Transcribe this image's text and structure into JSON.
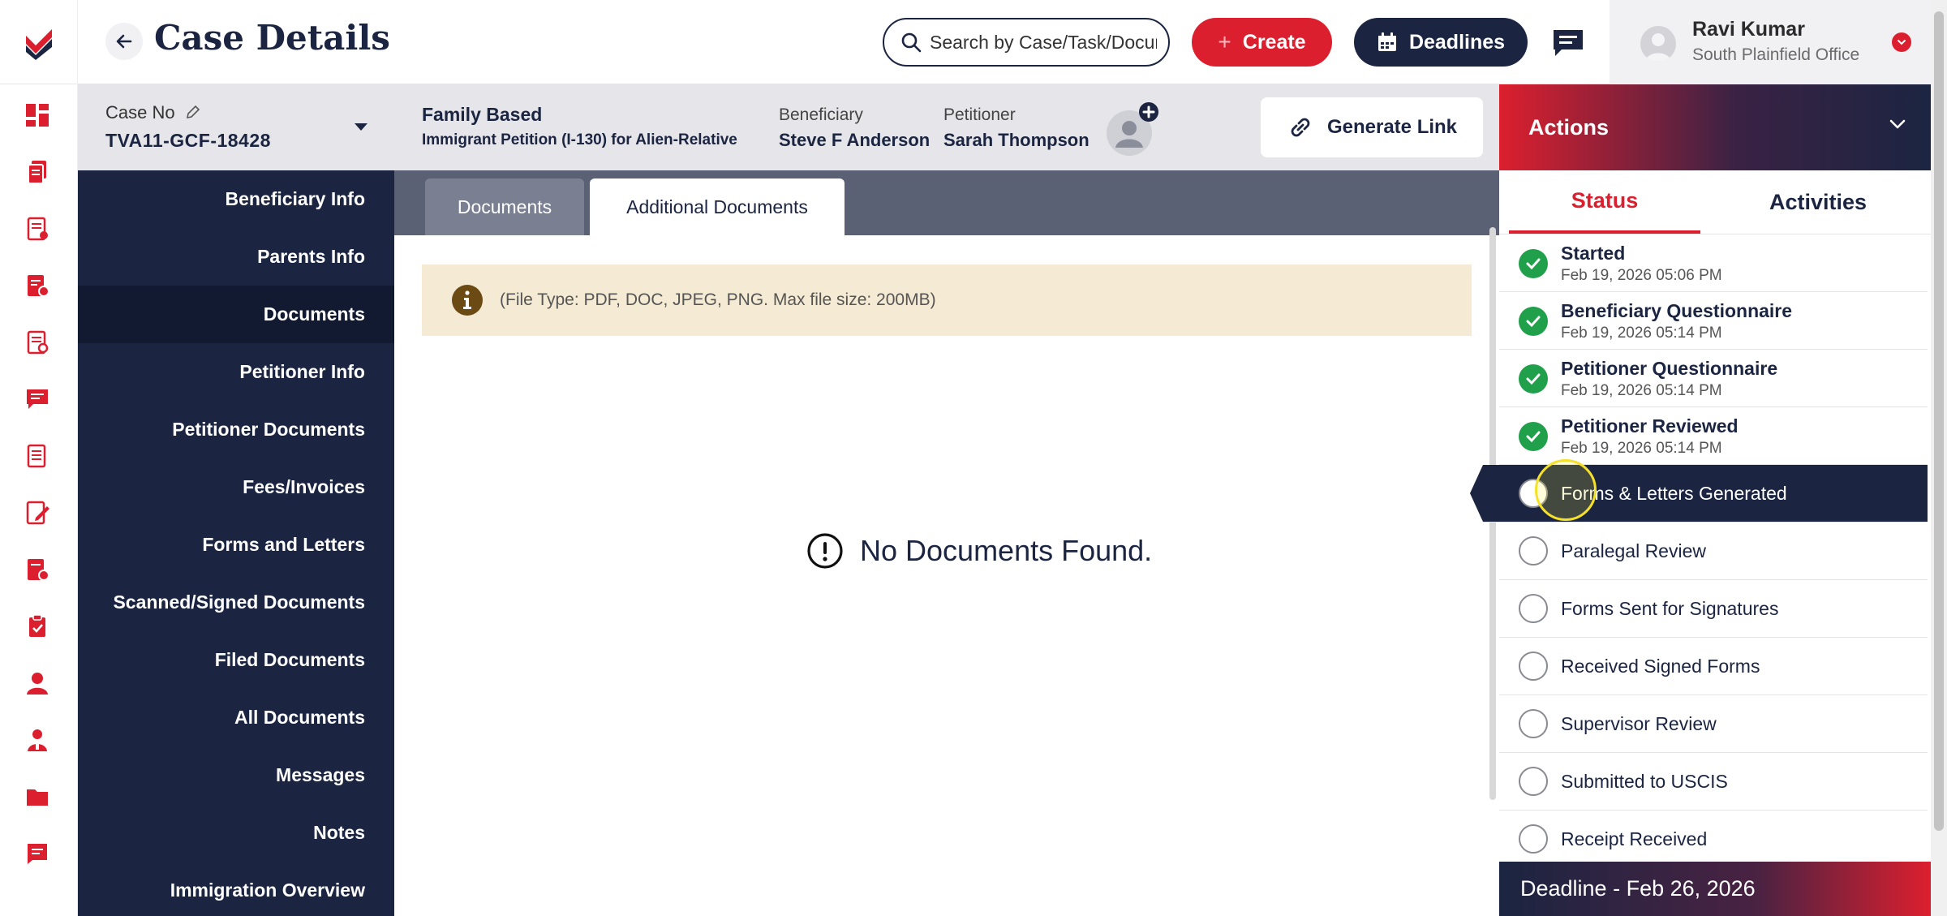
{
  "header": {
    "title": "Case Details",
    "search_placeholder": "Search by Case/Task/Document",
    "create_label": "Create",
    "deadlines_label": "Deadlines",
    "user_name": "Ravi Kumar",
    "user_office": "South Plainfield Office"
  },
  "case": {
    "no_label": "Case No",
    "no_value": "TVA11-GCF-18428",
    "category": "Family Based",
    "petition_type": "Immigrant Petition (I-130) for Alien-Relative",
    "beneficiary_label": "Beneficiary",
    "beneficiary_name": "Steve F Anderson",
    "petitioner_label": "Petitioner",
    "petitioner_name": "Sarah Thompson",
    "generate_link_label": "Generate Link"
  },
  "section_nav": {
    "items": [
      {
        "label": "Beneficiary Info"
      },
      {
        "label": "Parents Info"
      },
      {
        "label": "Documents"
      },
      {
        "label": "Petitioner Info"
      },
      {
        "label": "Petitioner Documents"
      },
      {
        "label": "Fees/Invoices"
      },
      {
        "label": "Forms and Letters"
      },
      {
        "label": "Scanned/Signed Documents"
      },
      {
        "label": "Filed Documents"
      },
      {
        "label": "All Documents"
      },
      {
        "label": "Messages"
      },
      {
        "label": "Notes"
      },
      {
        "label": "Immigration Overview"
      }
    ]
  },
  "main": {
    "tabs": [
      {
        "label": "Documents"
      },
      {
        "label": "Additional Documents"
      }
    ],
    "info_text": "(File Type: PDF, DOC, JPEG, PNG. Max file size: 200MB)",
    "empty_text": "No Documents Found."
  },
  "actions": {
    "title": "Actions",
    "tabs": [
      {
        "label": "Status"
      },
      {
        "label": "Activities"
      }
    ],
    "statuses": [
      {
        "label": "Started",
        "date": "Feb 19, 2026 05:06 PM"
      },
      {
        "label": "Beneficiary Questionnaire",
        "date": "Feb 19, 2026 05:14 PM"
      },
      {
        "label": "Petitioner Questionnaire",
        "date": "Feb 19, 2026 05:14 PM"
      },
      {
        "label": "Petitioner Reviewed",
        "date": "Feb 19, 2026 05:14 PM"
      },
      {
        "label": "Forms & Letters Generated"
      },
      {
        "label": "Paralegal Review"
      },
      {
        "label": "Forms Sent for Signatures"
      },
      {
        "label": "Received Signed Forms"
      },
      {
        "label": "Supervisor Review"
      },
      {
        "label": "Submitted to USCIS"
      },
      {
        "label": "Receipt Received"
      }
    ],
    "deadline": "Deadline - Feb 26, 2026"
  },
  "colors": {
    "navy": "#1b2541",
    "brand_red": "#dc1f2e",
    "done_green": "#20a04a",
    "info_banner": "#f5ead3"
  },
  "icons": {
    "rail": [
      "dashboard-icon",
      "cases-icon",
      "tasks-icon",
      "invoices-icon",
      "forms-icon",
      "messages-icon",
      "documents-icon",
      "notes-icon",
      "reports-icon",
      "checklist-icon",
      "user-icon",
      "team-icon",
      "folder-icon",
      "chat-icon"
    ]
  }
}
